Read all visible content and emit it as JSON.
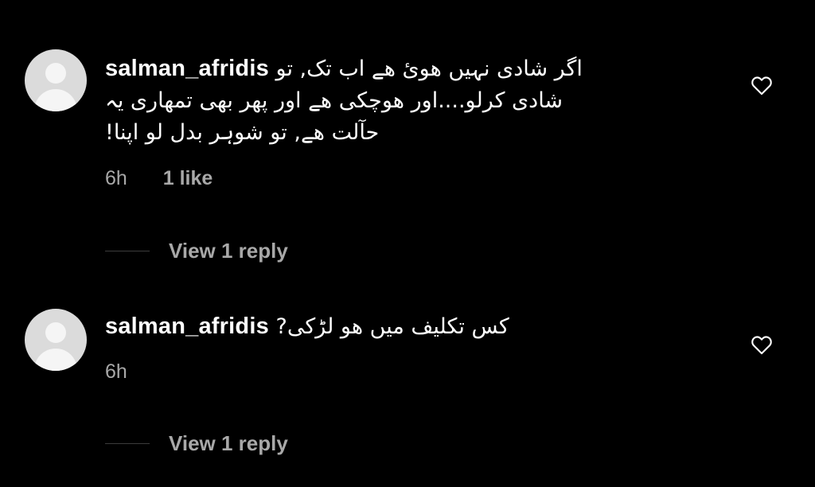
{
  "comments": [
    {
      "username": "salman_afridis",
      "lines": [
        "اگر شادی نہیں ھوئ ھے اب تک, تو",
        "شادی کرلو....اور ھوچکی ھے اور پھر بھی تمھاری یہ",
        "حآلت ھے, تو شوہر بدل لو اپنا!"
      ],
      "time": "6h",
      "likes": "1 like",
      "view_replies": "View 1 reply"
    },
    {
      "username": "salman_afridis",
      "lines": [
        "کس تکلیف میں ھو لڑکی?"
      ],
      "time": "6h",
      "view_replies": "View 1 reply"
    }
  ],
  "icons": {
    "avatar": "default-avatar-icon",
    "like": "heart-outline-icon"
  },
  "colors": {
    "background": "#000000",
    "text": "#ffffff",
    "muted": "#a8a8a8"
  }
}
